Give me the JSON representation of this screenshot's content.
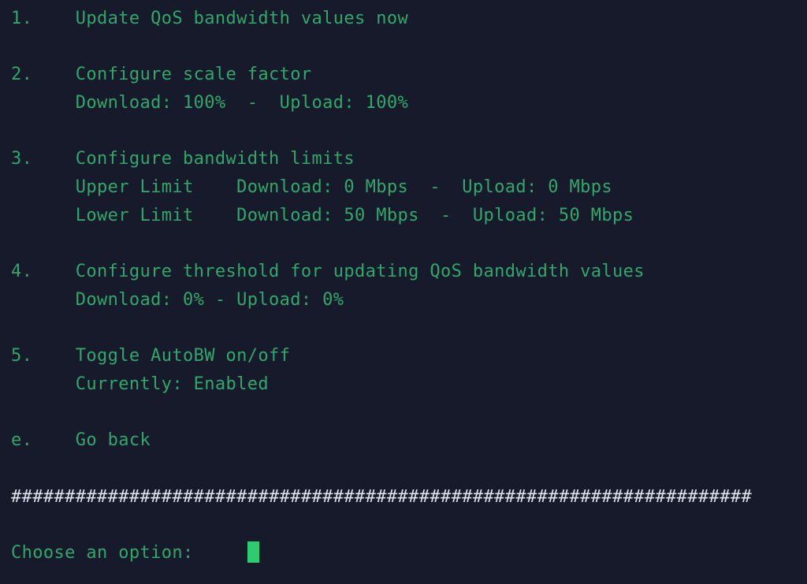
{
  "terminal": {
    "colors": {
      "background": "#161a2b",
      "text": "#2fa869",
      "separator": "#dfe3ee",
      "cursor": "#2ecc71"
    },
    "menu_items": [
      {
        "key": "1.",
        "label": "Update QoS bandwidth values now",
        "line": "1.    Update QoS bandwidth values now",
        "details": []
      },
      {
        "key": "2.",
        "label": "Configure scale factor",
        "line": "2.    Configure scale factor",
        "details": [
          "      Download: 100%  -  Upload: 100%"
        ]
      },
      {
        "key": "3.",
        "label": "Configure bandwidth limits",
        "line": "3.    Configure bandwidth limits",
        "details": [
          "      Upper Limit    Download: 0 Mbps  -  Upload: 0 Mbps",
          "      Lower Limit    Download: 50 Mbps  -  Upload: 50 Mbps"
        ]
      },
      {
        "key": "4.",
        "label": "Configure threshold for updating QoS bandwidth values",
        "line": "4.    Configure threshold for updating QoS bandwidth values",
        "details": [
          "      Download: 0% - Upload: 0%"
        ]
      },
      {
        "key": "5.",
        "label": "Toggle AutoBW on/off",
        "line": "5.    Toggle AutoBW on/off",
        "details": [
          "      Currently: Enabled"
        ]
      },
      {
        "key": "e.",
        "label": "Go back",
        "line": "e.    Go back",
        "details": []
      }
    ],
    "values": {
      "scale_factor_download": "100%",
      "scale_factor_upload": "100%",
      "upper_limit_download": "0 Mbps",
      "upper_limit_upload": "0 Mbps",
      "lower_limit_download": "50 Mbps",
      "lower_limit_upload": "50 Mbps",
      "threshold_download": "0%",
      "threshold_upload": "0%",
      "autobw_state": "Enabled"
    },
    "separator": "#####################################################################",
    "prompt": "Choose an option:",
    "prompt_line": "Choose an option:     ",
    "input_value": ""
  }
}
